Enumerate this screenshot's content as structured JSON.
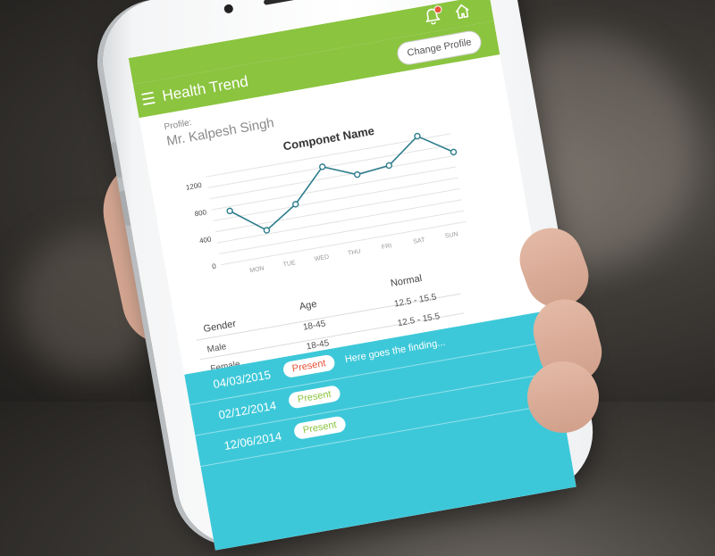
{
  "header": {
    "title": "Health Trend",
    "change_profile_label": "Change Profile"
  },
  "profile": {
    "label": "Profile:",
    "name": "Mr. Kalpesh Singh"
  },
  "chart_data": {
    "type": "line",
    "title": "Componet Name",
    "categories": [
      "MON",
      "TUE",
      "WED",
      "THU",
      "FRI",
      "SAT",
      "SUN"
    ],
    "y_ticks": [
      "0",
      "400",
      "800",
      "1200"
    ],
    "ylim": [
      0,
      1300
    ],
    "series": [
      {
        "values": [
          750,
          380,
          680,
          1150,
          950,
          1000,
          1350,
          1030
        ]
      }
    ],
    "point_count": 8,
    "colors": {
      "line": "#2e7d8c",
      "point": "#ffffff",
      "grid": "#e3e3e3"
    }
  },
  "normal_table": {
    "headers": [
      "Gender",
      "Age",
      "Normal"
    ],
    "rows": [
      [
        "Male",
        "18-45",
        "12.5 - 15.5"
      ],
      [
        "Female",
        "18-45",
        "12.5 - 15.5"
      ]
    ]
  },
  "findings": [
    {
      "date": "04/03/2015",
      "status": "Present",
      "status_color": "#e8543a",
      "text": "Here goes the finding..."
    },
    {
      "date": "02/12/2014",
      "status": "Present",
      "status_color": "#8bc43f",
      "text": ""
    },
    {
      "date": "12/06/2014",
      "status": "Present",
      "status_color": "#8bc43f",
      "text": ""
    }
  ],
  "icons": {
    "notification": "bell-icon",
    "home": "home-icon",
    "menu": "hamburger-menu-icon"
  },
  "colors": {
    "accent_green": "#8bc43f",
    "findings_teal": "#3dc8d9"
  }
}
